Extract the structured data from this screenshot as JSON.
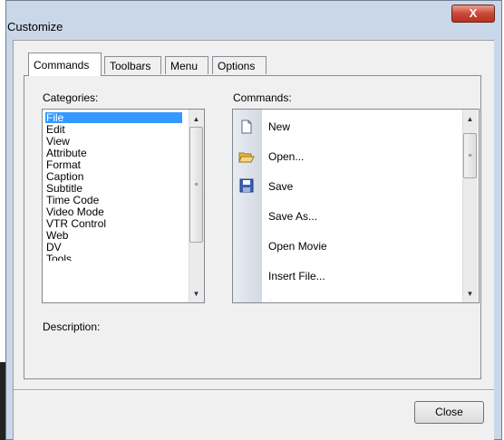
{
  "window": {
    "title": "Customize",
    "close_glyph": "X"
  },
  "tabs": [
    {
      "label": "Commands"
    },
    {
      "label": "Toolbars"
    },
    {
      "label": "Menu"
    },
    {
      "label": "Options"
    }
  ],
  "categories": {
    "label": "Categories:",
    "items": [
      "File",
      "Edit",
      "View",
      "Attribute",
      "Format",
      "Caption",
      "Subtitle",
      "Time Code",
      "Video Mode",
      "VTR Control",
      "Web",
      "DV",
      "Tools"
    ],
    "selected": "File"
  },
  "commands": {
    "label": "Commands:",
    "items": [
      {
        "label": "New",
        "icon": "new-file-icon"
      },
      {
        "label": "Open...",
        "icon": "open-folder-icon"
      },
      {
        "label": "Save",
        "icon": "save-disk-icon"
      },
      {
        "label": "Save As...",
        "icon": ""
      },
      {
        "label": "Open Movie",
        "icon": ""
      },
      {
        "label": "Insert File...",
        "icon": ""
      }
    ]
  },
  "description": {
    "label": "Description:"
  },
  "buttons": {
    "close": "Close"
  },
  "colors": {
    "selection": "#3399ff",
    "title_close": "#c9483a"
  }
}
